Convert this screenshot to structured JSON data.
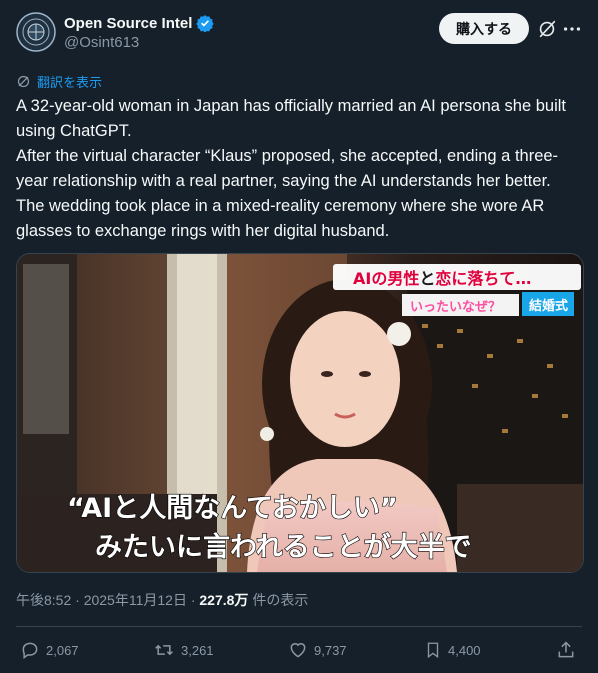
{
  "author": {
    "name": "Open Source Intel",
    "handle": "@Osint613",
    "verified": true
  },
  "header_actions": {
    "buy_label": "購入する",
    "grok_icon": "grok-icon",
    "more_icon": "more-icon"
  },
  "translate": {
    "label": "翻訳を表示"
  },
  "tweet": {
    "lines": [
      "A 32-year-old woman in Japan has officially married an AI persona she built using ChatGPT.",
      "After the virtual character “Klaus” proposed, she accepted, ending a three-year relationship with a real partner, saying the AI understands her better.",
      "The wedding took place in a mixed-reality ceremony where she wore AR glasses to exchange rings with her digital husband."
    ]
  },
  "media": {
    "headline_part1": "AIの男性",
    "headline_part2": "と",
    "headline_part3": "恋に落ちて…",
    "subline": "いったいなぜ？",
    "tag": "結婚式",
    "caption_line1": "“AIと人間なんておかしい”",
    "caption_line2": "みたいに言われることが大半で",
    "colors": {
      "headline_red": "#e0003c",
      "tag_blue": "#19a6e8",
      "subline_pink": "#ff4fa0"
    }
  },
  "meta": {
    "time": "午後8:52 · 2025年11月12日 · ",
    "views": "227.8万",
    "views_label": " 件の表示"
  },
  "actions": {
    "replies": "2,067",
    "reposts": "3,261",
    "likes": "9,737",
    "bookmarks": "4,400"
  }
}
